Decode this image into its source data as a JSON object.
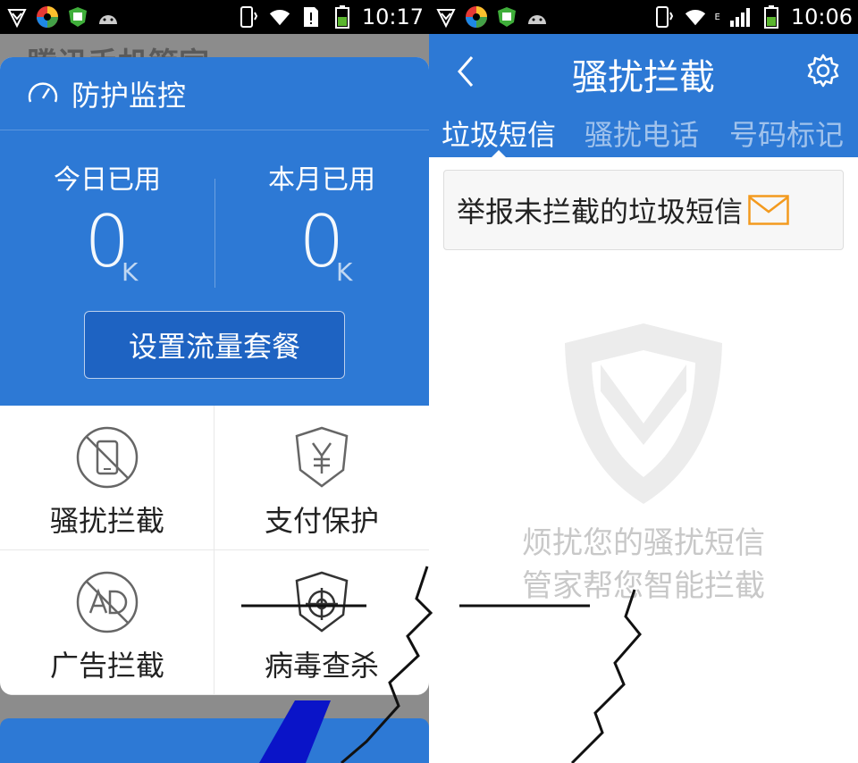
{
  "status_left": {
    "time": "10:17"
  },
  "status_right": {
    "time": "10:06",
    "network": "E"
  },
  "left": {
    "behind_title": "腾讯手机管家",
    "card_title": "防护监控",
    "today_label": "今日已用",
    "today_value": "0",
    "today_unit": "K",
    "month_label": "本月已用",
    "month_value": "0",
    "month_unit": "K",
    "set_plan": "设置流量套餐",
    "tiles": [
      {
        "label": "骚扰拦截",
        "icon": "no-phone-icon"
      },
      {
        "label": "支付保护",
        "icon": "yuan-shield-icon"
      },
      {
        "label": "广告拦截",
        "icon": "no-ad-icon"
      },
      {
        "label": "病毒查杀",
        "icon": "target-shield-icon"
      }
    ]
  },
  "right": {
    "title": "骚扰拦截",
    "tabs": [
      "垃圾短信",
      "骚扰电话",
      "号码标记"
    ],
    "active_tab": 0,
    "report": "举报未拦截的垃圾短信",
    "empty_line1": "烦扰您的骚扰短信",
    "empty_line2": "管家帮您智能拦截"
  },
  "colors": {
    "primary": "#2d79d5",
    "mail": "#f39a1e",
    "empty": "#c8c8c8"
  }
}
